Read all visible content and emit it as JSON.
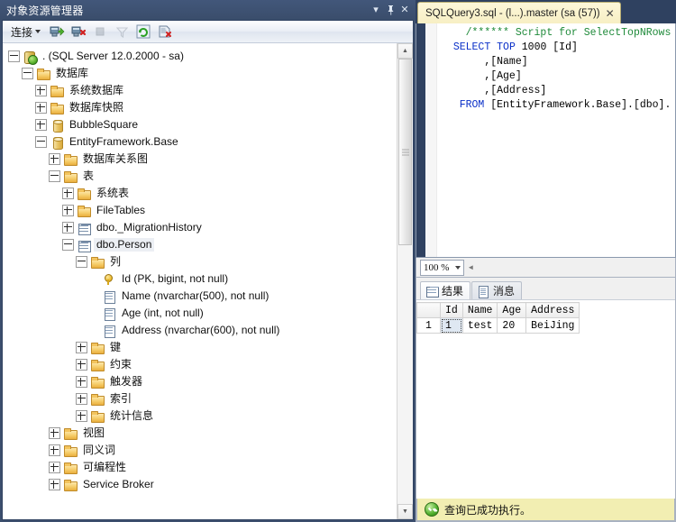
{
  "object_explorer": {
    "title": "对象资源管理器",
    "window_buttons": [
      {
        "name": "chevron-down-icon",
        "glyph": "▾"
      },
      {
        "name": "pin-icon",
        "glyph": "⚲"
      },
      {
        "name": "close-icon",
        "glyph": "✕"
      }
    ],
    "toolbar": {
      "connect_label": "连接",
      "icons": [
        "connect-object-explorer-icon",
        "disconnect-object-explorer-icon",
        "stop-icon",
        "filter-icon",
        "refresh-icon",
        "script-icon"
      ]
    },
    "tree": [
      {
        "indent": 0,
        "state": "minus",
        "icon": "server",
        "label": ". (SQL Server 12.0.2000 - sa)",
        "selected": false
      },
      {
        "indent": 1,
        "state": "minus",
        "icon": "folder",
        "label": "数据库",
        "selected": false
      },
      {
        "indent": 2,
        "state": "plus",
        "icon": "folder",
        "label": "系统数据库",
        "selected": false
      },
      {
        "indent": 2,
        "state": "plus",
        "icon": "folder",
        "label": "数据库快照",
        "selected": false
      },
      {
        "indent": 2,
        "state": "plus",
        "icon": "db",
        "label": "BubbleSquare",
        "selected": false
      },
      {
        "indent": 2,
        "state": "minus",
        "icon": "db",
        "label": "EntityFramework.Base",
        "selected": false
      },
      {
        "indent": 3,
        "state": "plus",
        "icon": "folder",
        "label": "数据库关系图",
        "selected": false
      },
      {
        "indent": 3,
        "state": "minus",
        "icon": "folder",
        "label": "表",
        "selected": false
      },
      {
        "indent": 4,
        "state": "plus",
        "icon": "folder",
        "label": "系统表",
        "selected": false
      },
      {
        "indent": 4,
        "state": "plus",
        "icon": "folder",
        "label": "FileTables",
        "selected": false
      },
      {
        "indent": 4,
        "state": "plus",
        "icon": "table",
        "label": "dbo._MigrationHistory",
        "selected": false
      },
      {
        "indent": 4,
        "state": "minus",
        "icon": "table",
        "label": "dbo.Person",
        "selected": true
      },
      {
        "indent": 5,
        "state": "minus",
        "icon": "folder",
        "label": "列",
        "selected": false
      },
      {
        "indent": 6,
        "state": "none",
        "icon": "key",
        "label": "Id (PK, bigint, not null)",
        "selected": false
      },
      {
        "indent": 6,
        "state": "none",
        "icon": "col",
        "label": "Name (nvarchar(500), not null)",
        "selected": false
      },
      {
        "indent": 6,
        "state": "none",
        "icon": "col",
        "label": "Age (int, not null)",
        "selected": false
      },
      {
        "indent": 6,
        "state": "none",
        "icon": "col",
        "label": "Address (nvarchar(600), not null)",
        "selected": false
      },
      {
        "indent": 5,
        "state": "plus",
        "icon": "folder",
        "label": "键",
        "selected": false
      },
      {
        "indent": 5,
        "state": "plus",
        "icon": "folder",
        "label": "约束",
        "selected": false
      },
      {
        "indent": 5,
        "state": "plus",
        "icon": "folder",
        "label": "触发器",
        "selected": false
      },
      {
        "indent": 5,
        "state": "plus",
        "icon": "folder",
        "label": "索引",
        "selected": false
      },
      {
        "indent": 5,
        "state": "plus",
        "icon": "folder",
        "label": "统计信息",
        "selected": false
      },
      {
        "indent": 3,
        "state": "plus",
        "icon": "folder",
        "label": "视图",
        "selected": false
      },
      {
        "indent": 3,
        "state": "plus",
        "icon": "folder",
        "label": "同义词",
        "selected": false
      },
      {
        "indent": 3,
        "state": "plus",
        "icon": "folder",
        "label": "可编程性",
        "selected": false
      },
      {
        "indent": 3,
        "state": "plus",
        "icon": "folder",
        "label": "Service Broker",
        "selected": false
      }
    ],
    "scrollbar": {
      "up_arrow": "▲",
      "down_arrow": "▼"
    }
  },
  "editor": {
    "tab_title": "SQLQuery3.sql - (l...).master (sa (57))",
    "close_glyph": "✕",
    "code_lines": [
      {
        "indent": 4,
        "parts": [
          {
            "t": "comment",
            "v": "/****** Script for SelectTopNRows c"
          }
        ]
      },
      {
        "indent": 2,
        "parts": [
          {
            "t": "kw",
            "v": "SELECT"
          },
          {
            "t": "plain",
            "v": " "
          },
          {
            "t": "kw",
            "v": "TOP"
          },
          {
            "t": "plain",
            "v": " 1000 [Id]"
          }
        ]
      },
      {
        "indent": 7,
        "parts": [
          {
            "t": "plain",
            "v": ",[Name]"
          }
        ]
      },
      {
        "indent": 7,
        "parts": [
          {
            "t": "plain",
            "v": ",[Age]"
          }
        ]
      },
      {
        "indent": 7,
        "parts": [
          {
            "t": "plain",
            "v": ",[Address]"
          }
        ]
      },
      {
        "indent": 3,
        "parts": [
          {
            "t": "kw",
            "v": "FROM"
          },
          {
            "t": "plain",
            "v": " [EntityFramework.Base].[dbo]."
          }
        ]
      }
    ]
  },
  "zoombar": {
    "zoom_value": "100 %",
    "chevron": "▾"
  },
  "results": {
    "tabs": [
      {
        "label": "结果",
        "icon": "grid-icon",
        "active": true
      },
      {
        "label": "消息",
        "icon": "message-icon",
        "active": false
      }
    ],
    "columns": [
      "Id",
      "Name",
      "Age",
      "Address"
    ],
    "rows": [
      {
        "row_number": "1",
        "cells": [
          "1",
          "test",
          "20",
          "BeiJing"
        ]
      }
    ],
    "selected_cell": {
      "row": 0,
      "col": 0
    }
  },
  "status": {
    "icon": "success-check-icon",
    "text": "查询已成功执行。"
  },
  "colors": {
    "chrome": "#3c4f6e",
    "tab_bg": "#f7efc4",
    "status_bg": "#f2eeb2",
    "keyword": "#0b30c8",
    "comment": "#1f8a3a",
    "selection": "#dfe8f2"
  }
}
